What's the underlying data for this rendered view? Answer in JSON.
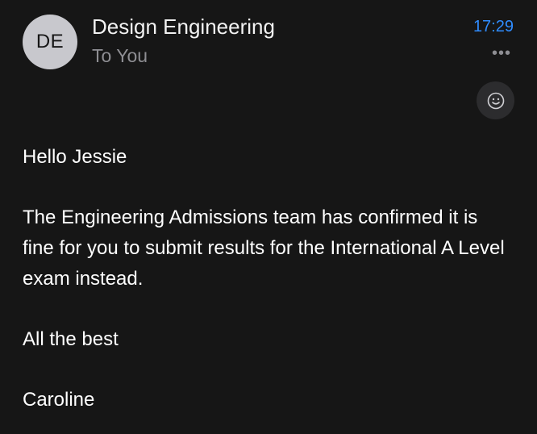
{
  "header": {
    "avatar_initials": "DE",
    "sender": "Design Engineering",
    "recipient": "To You",
    "time": "17:29",
    "more_icon": "ellipsis-icon",
    "reaction_icon": "smiley-icon"
  },
  "message": {
    "greeting": "Hello Jessie",
    "paragraph": "The Engineering Admissions team has confirmed it is fine for you to submit results for the International A Level exam instead.",
    "signoff": "All the best",
    "signature": "Caroline"
  },
  "colors": {
    "background": "#161616",
    "accent": "#2f8cff",
    "secondary_text": "#8e8e93",
    "avatar_bg": "#c8c8cd"
  }
}
